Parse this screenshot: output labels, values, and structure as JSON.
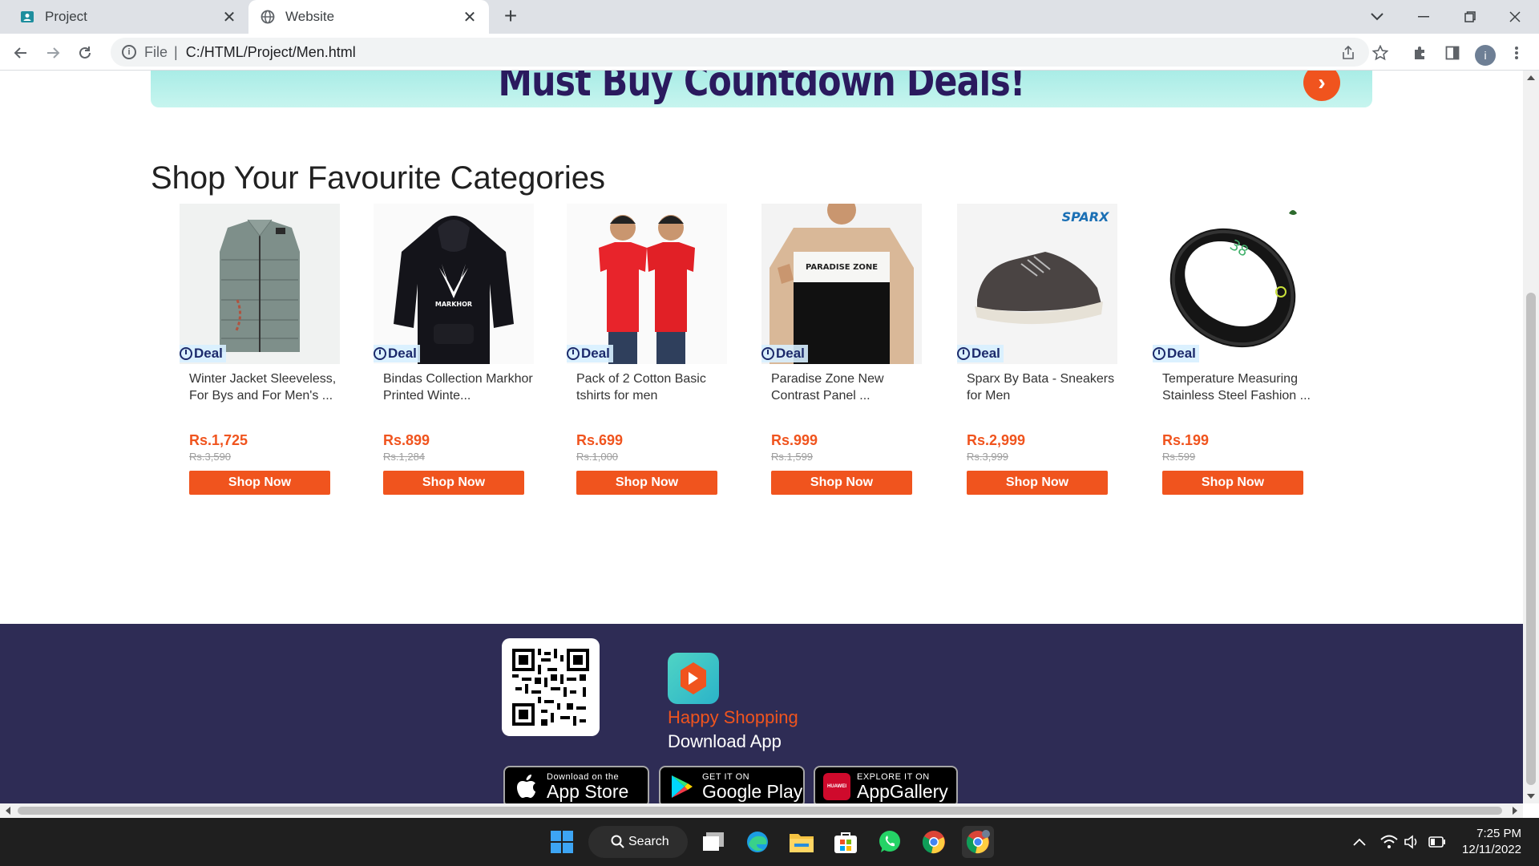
{
  "browser": {
    "tabs": [
      {
        "label": "Project",
        "icon": "classroom-icon"
      },
      {
        "label": "Website",
        "icon": "globe-icon"
      }
    ],
    "new_tab_symbol": "+",
    "address": {
      "scheme": "File",
      "separator": "|",
      "url": "C:/HTML/Project/Men.html"
    },
    "profile_initial": "i"
  },
  "banner": {
    "text": "Must Buy Countdown Deals!",
    "arrow": "›"
  },
  "section": {
    "title": "Shop Your Favourite Categories"
  },
  "deal_label": "Deal",
  "shop_label": "Shop Now",
  "products": [
    {
      "name": "Winter Jacket Sleeveless, For Bys and For Men's ...",
      "price": "Rs.1,725",
      "old_price": "Rs.3,590",
      "image": "grey-puffer-vest"
    },
    {
      "name": "Bindas Collection Markhor Printed Winte...",
      "price": "Rs.899",
      "old_price": "Rs.1,284",
      "image": "black-hoodie-markhor",
      "print_text": "MARKHOR"
    },
    {
      "name": "Pack of 2 Cotton Basic tshirts for men",
      "price": "Rs.699",
      "old_price": "Rs.1,000",
      "image": "two-red-tshirts"
    },
    {
      "name": "Paradise Zone New Contrast Panel ...",
      "price": "Rs.999",
      "old_price": "Rs.1,599",
      "image": "contrast-sweatshirt",
      "print_text": "PARADISE ZONE"
    },
    {
      "name": "Sparx By Bata - Sneakers for Men",
      "price": "Rs.2,999",
      "old_price": "Rs.3,999",
      "image": "grey-sneaker",
      "brand": "SPARX"
    },
    {
      "name": "Temperature Measuring Stainless Steel Fashion ...",
      "price": "Rs.199",
      "old_price": "Rs.599",
      "image": "black-smart-ring",
      "display_text": "38"
    }
  ],
  "footer": {
    "happy": "Happy Shopping",
    "download": "Download App",
    "stores": [
      {
        "small": "Download on the",
        "big": "App Store",
        "icon": "apple-icon"
      },
      {
        "small": "GET IT ON",
        "big": "Google Play",
        "icon": "google-play-icon"
      },
      {
        "small": "EXPLORE IT ON",
        "big": "AppGallery",
        "icon": "huawei-icon",
        "badge": "HUAWEI"
      }
    ]
  },
  "taskbar": {
    "search_label": "Search",
    "time": "7:25 PM",
    "date": "12/11/2022"
  }
}
